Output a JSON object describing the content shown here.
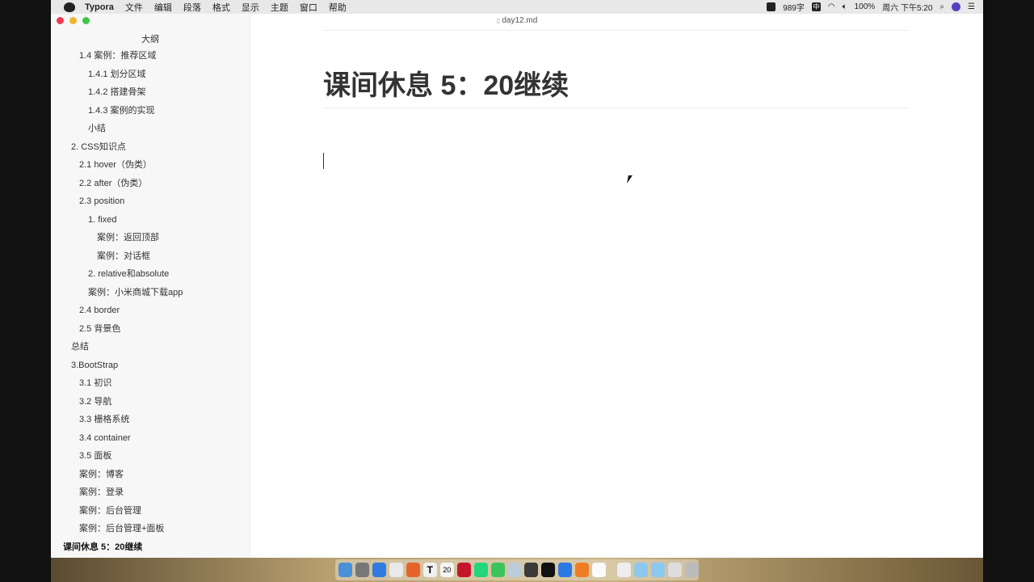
{
  "menubar": {
    "app": "Typora",
    "items": [
      "文件",
      "编辑",
      "段落",
      "格式",
      "显示",
      "主题",
      "窗口",
      "帮助"
    ],
    "status": {
      "word_count": "989字",
      "input_method": "中",
      "battery": "100%",
      "clock": "周六 下午5:20"
    }
  },
  "window": {
    "filename": "day12.md"
  },
  "sidebar": {
    "title": "大纲",
    "items": [
      {
        "label": "1.4 案例：推荐区域",
        "level": 2
      },
      {
        "label": "1.4.1 划分区域",
        "level": 3
      },
      {
        "label": "1.4.2 搭建骨架",
        "level": 3
      },
      {
        "label": "1.4.3 案例的实现",
        "level": 3
      },
      {
        "label": "小结",
        "level": 3
      },
      {
        "label": "2. CSS知识点",
        "level": 1
      },
      {
        "label": "2.1 hover（伪类）",
        "level": 2
      },
      {
        "label": "2.2 after（伪类）",
        "level": 2
      },
      {
        "label": "2.3 position",
        "level": 2
      },
      {
        "label": "1. fixed",
        "level": 3
      },
      {
        "label": "案例：返回顶部",
        "level": 4
      },
      {
        "label": "案例：对话框",
        "level": 4
      },
      {
        "label": "2. relative和absolute",
        "level": 3
      },
      {
        "label": "案例：小米商城下载app",
        "level": 3
      },
      {
        "label": "2.4 border",
        "level": 2
      },
      {
        "label": "2.5 背景色",
        "level": 2
      },
      {
        "label": "总结",
        "level": 1
      },
      {
        "label": "3.BootStrap",
        "level": 1
      },
      {
        "label": "3.1 初识",
        "level": 2
      },
      {
        "label": "3.2 导航",
        "level": 2
      },
      {
        "label": "3.3 栅格系统",
        "level": 2
      },
      {
        "label": "3.4 container",
        "level": 2
      },
      {
        "label": "3.5 面板",
        "level": 2
      },
      {
        "label": "案例：博客",
        "level": 2
      },
      {
        "label": "案例：登录",
        "level": 2
      },
      {
        "label": "案例：后台管理",
        "level": 2
      },
      {
        "label": "案例：后台管理+面板",
        "level": 2
      },
      {
        "label": "课间休息 5：20继续",
        "level": 0,
        "active": true
      }
    ]
  },
  "editor": {
    "heading": "课间休息 5：20继续"
  },
  "dock": {
    "apps": [
      "finder",
      "launchpad",
      "safari",
      "chrome",
      "firefox",
      "typora",
      "calendar",
      "netease-music",
      "pycharm",
      "wechat",
      "preview",
      "sublime",
      "terminal",
      "feishu",
      "photo-booth",
      "pages"
    ],
    "calendar_day": "20",
    "colors": [
      "#4a90d9",
      "#777",
      "#2f7be0",
      "#e9e9e9",
      "#e8632b",
      "#f0f0f0",
      "#f4f4f4",
      "#c4162a",
      "#22d67b",
      "#3cc45c",
      "#bcd",
      "#3a3a3a",
      "#111",
      "#2a7ae2",
      "#ef7d23",
      "#fafafa"
    ]
  }
}
